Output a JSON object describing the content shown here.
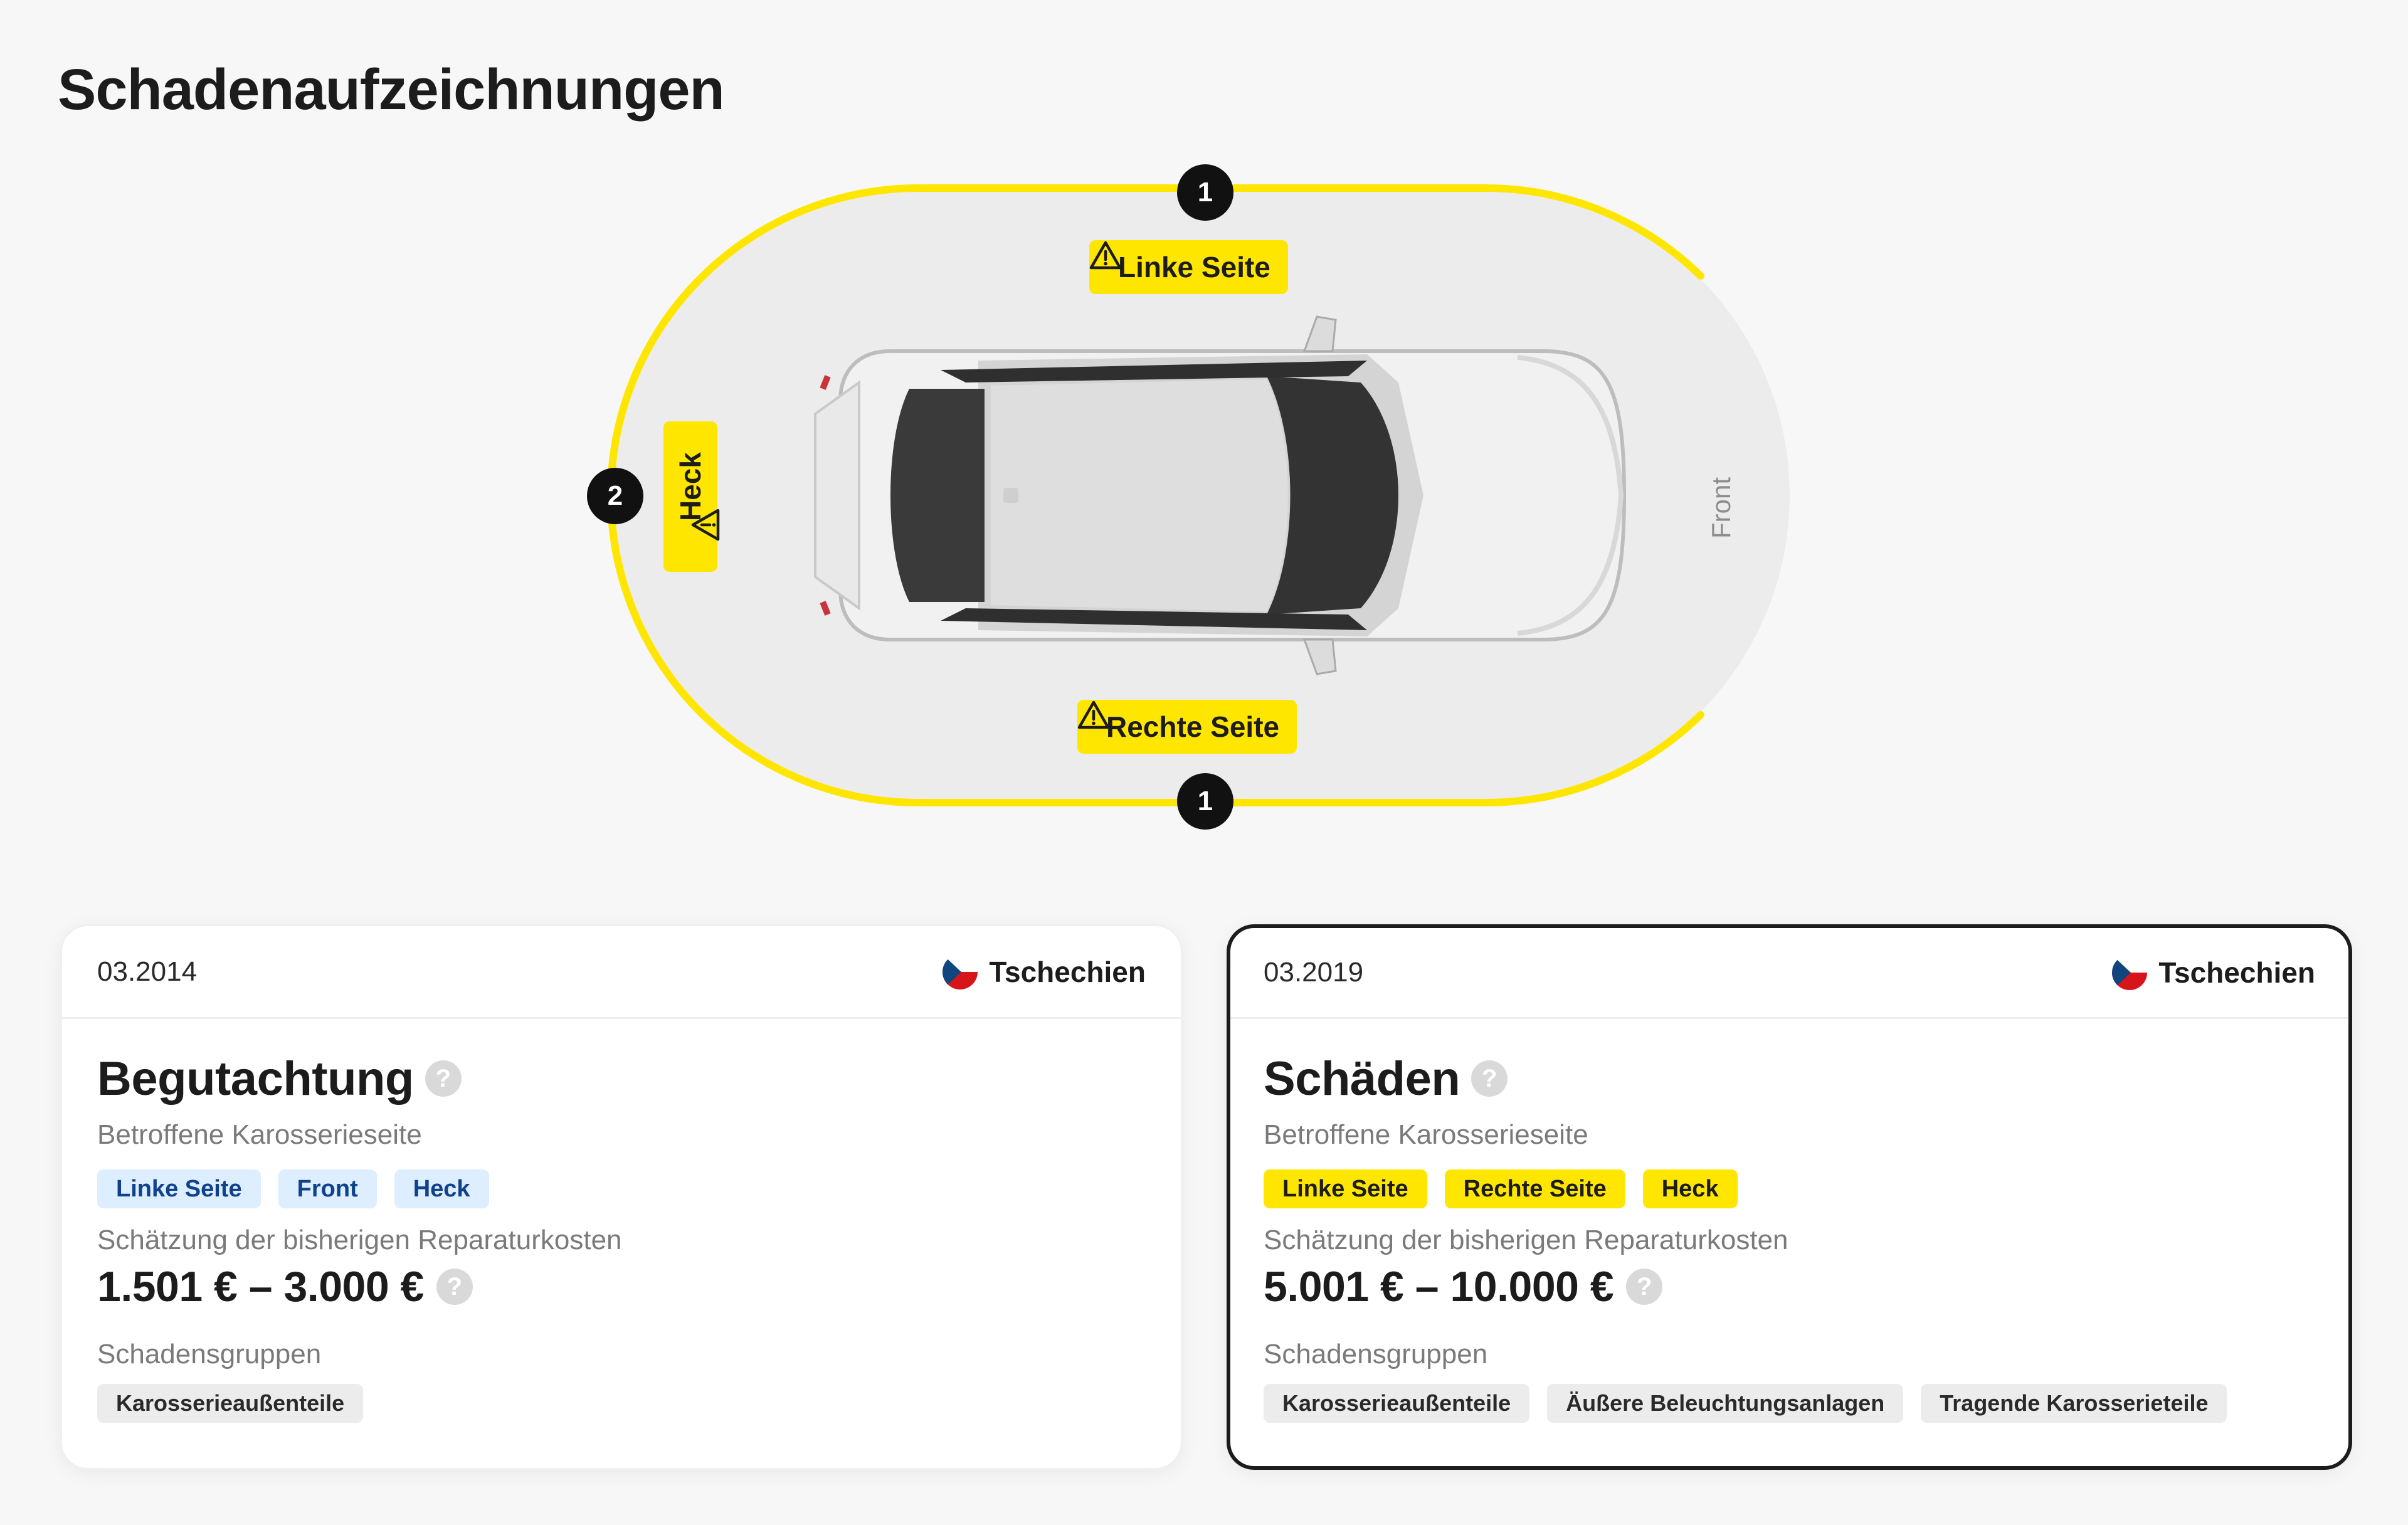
{
  "page": {
    "title": "Schadenaufzeichnungen"
  },
  "diagram": {
    "front_label": "Front",
    "zones": [
      {
        "label": "Linke Seite",
        "count": "1"
      },
      {
        "label": "Rechte Seite",
        "count": "1"
      },
      {
        "label": "Heck",
        "count": "2"
      }
    ],
    "highlight_color": "#ffe600"
  },
  "records": [
    {
      "date": "03.2014",
      "country": "Tschechien",
      "title": "Begutachtung",
      "help": "?",
      "sides_label": "Betroffene Karosserieseite",
      "sides": [
        "Linke Seite",
        "Front",
        "Heck"
      ],
      "cost_label": "Schätzung der bisherigen Reparaturkosten",
      "cost": "1.501 € – 3.000 €",
      "groups_label": "Schadensgruppen",
      "groups": [
        "Karosserieaußenteile"
      ],
      "chip_color": "#dceeff"
    },
    {
      "date": "03.2019",
      "country": "Tschechien",
      "title": "Schäden",
      "help": "?",
      "sides_label": "Betroffene Karosserieseite",
      "sides": [
        "Linke Seite",
        "Rechte Seite",
        "Heck"
      ],
      "cost_label": "Schätzung der bisherigen Reparaturkosten",
      "cost": "5.001 € – 10.000 €",
      "groups_label": "Schadensgruppen",
      "groups": [
        "Karosserieaußenteile",
        "Äußere Beleuchtungsanlagen",
        "Tragende Karosserieteile"
      ],
      "chip_color": "#ffe600"
    }
  ]
}
